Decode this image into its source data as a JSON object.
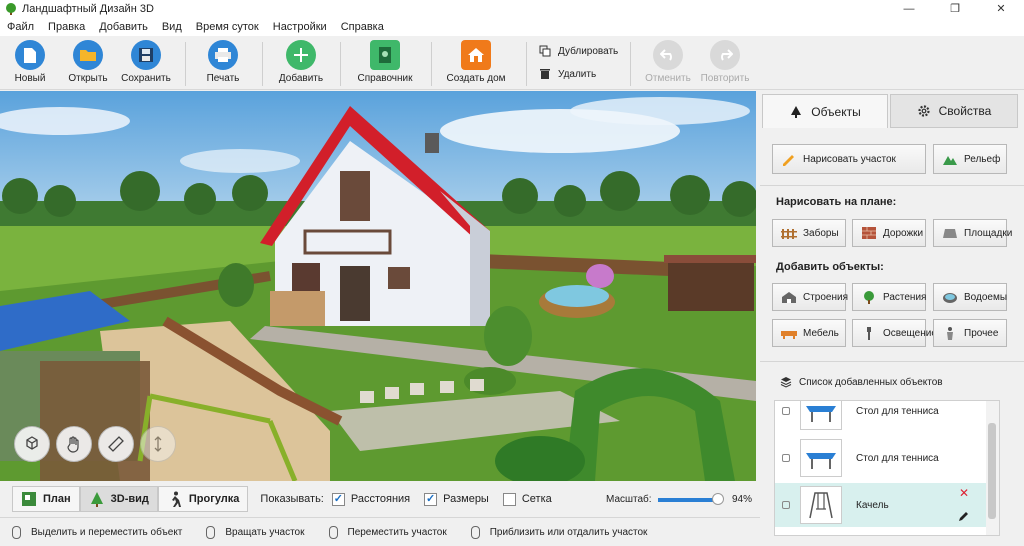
{
  "window": {
    "title": "Ландшафтный Дизайн 3D",
    "controls": [
      "—",
      "❐",
      "✕"
    ]
  },
  "menu": [
    "Файл",
    "Правка",
    "Добавить",
    "Вид",
    "Время суток",
    "Настройки",
    "Справка"
  ],
  "toolbar": {
    "new": "Новый",
    "open": "Открыть",
    "save": "Сохранить",
    "print": "Печать",
    "add": "Добавить",
    "reference": "Справочник",
    "create_house": "Создать дом",
    "duplicate": "Дублировать",
    "delete": "Удалить",
    "undo": "Отменить",
    "redo": "Повторить"
  },
  "viewbar": {
    "tabs": [
      "План",
      "3D-вид",
      "Прогулка"
    ],
    "active_tab": "3D-вид",
    "show_label": "Показывать:",
    "checks": [
      {
        "label": "Расстояния",
        "checked": true
      },
      {
        "label": "Размеры",
        "checked": true
      },
      {
        "label": "Сетка",
        "checked": false
      }
    ],
    "scale_label": "Масштаб:",
    "scale_value": "94%",
    "scale_fraction": 0.94
  },
  "status": [
    "Выделить и переместить объект",
    "Вращать участок",
    "Переместить участок",
    "Приблизить или отдалить участок"
  ],
  "panel": {
    "tabs": [
      "Объекты",
      "Свойства"
    ],
    "active_tab": "Объекты",
    "draw_plot": "Нарисовать участок",
    "relief": "Рельеф",
    "draw_on_plan": "Нарисовать на плане:",
    "fences": "Заборы",
    "paths": "Дорожки",
    "areas": "Площадки",
    "add_objects": "Добавить объекты:",
    "buildings": "Строения",
    "plants": "Растения",
    "ponds": "Водоемы",
    "furniture": "Мебель",
    "lighting": "Освещение",
    "other": "Прочее",
    "list_title": "Список добавленных объектов",
    "objects": [
      {
        "name": "Стол для тенниса",
        "selected": false
      },
      {
        "name": "Стол для тенниса",
        "selected": false
      },
      {
        "name": "Качель",
        "selected": true
      }
    ]
  },
  "colors": {
    "accent": "#2a7fd4",
    "add_green": "#3fb86a",
    "house_orange": "#f07a1a",
    "roof_red": "#d4232b",
    "selected_row": "#d8f0ee"
  }
}
